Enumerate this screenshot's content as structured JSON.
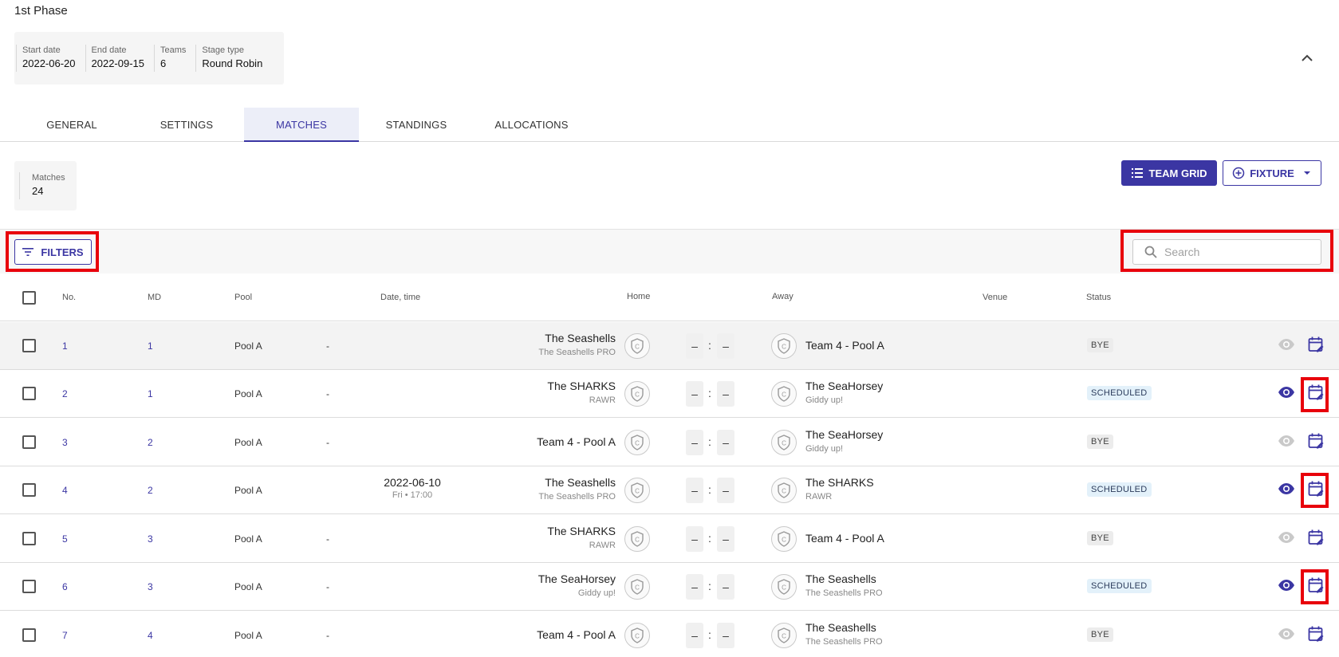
{
  "phase": {
    "title": "1st Phase",
    "info": [
      {
        "label": "Start date",
        "value": "2022-06-20"
      },
      {
        "label": "End date",
        "value": "2022-09-15"
      },
      {
        "label": "Teams",
        "value": "6"
      },
      {
        "label": "Stage type",
        "value": "Round Robin"
      }
    ]
  },
  "tabs": [
    {
      "label": "GENERAL",
      "active": false
    },
    {
      "label": "SETTINGS",
      "active": false
    },
    {
      "label": "MATCHES",
      "active": true
    },
    {
      "label": "STANDINGS",
      "active": false
    },
    {
      "label": "ALLOCATIONS",
      "active": false
    }
  ],
  "summary": {
    "label": "Matches",
    "value": "24"
  },
  "actions": {
    "team_grid": "TEAM GRID",
    "fixture": "FIXTURE"
  },
  "toolbar": {
    "filters": "FILTERS",
    "search_placeholder": "Search"
  },
  "table": {
    "headers": {
      "no": "No.",
      "md": "MD",
      "pool": "Pool",
      "datetime": "Date, time",
      "home": "Home",
      "away": "Away",
      "venue": "Venue",
      "status": "Status"
    },
    "rows": [
      {
        "no": "1",
        "md": "1",
        "pool": "Pool A",
        "dash": "-",
        "date": "",
        "time": "",
        "home": "The Seashells",
        "home_sub": "The Seashells PRO",
        "away": "Team 4 - Pool A",
        "away_sub": "",
        "score_home": "–",
        "score_away": "–",
        "status": "BYE",
        "eye_active": false
      },
      {
        "no": "2",
        "md": "1",
        "pool": "Pool A",
        "dash": "-",
        "date": "",
        "time": "",
        "home": "The SHARKS",
        "home_sub": "RAWR",
        "away": "The SeaHorsey",
        "away_sub": "Giddy up!",
        "score_home": "–",
        "score_away": "–",
        "status": "SCHEDULED",
        "eye_active": true
      },
      {
        "no": "3",
        "md": "2",
        "pool": "Pool A",
        "dash": "-",
        "date": "",
        "time": "",
        "home": "Team 4 - Pool A",
        "home_sub": "",
        "away": "The SeaHorsey",
        "away_sub": "Giddy up!",
        "score_home": "–",
        "score_away": "–",
        "status": "BYE",
        "eye_active": false
      },
      {
        "no": "4",
        "md": "2",
        "pool": "Pool A",
        "dash": "",
        "date": "2022-06-10",
        "time": "Fri • 17:00",
        "home": "The Seashells",
        "home_sub": "The Seashells PRO",
        "away": "The SHARKS",
        "away_sub": "RAWR",
        "score_home": "–",
        "score_away": "–",
        "status": "SCHEDULED",
        "eye_active": true
      },
      {
        "no": "5",
        "md": "3",
        "pool": "Pool A",
        "dash": "-",
        "date": "",
        "time": "",
        "home": "The SHARKS",
        "home_sub": "RAWR",
        "away": "Team 4 - Pool A",
        "away_sub": "",
        "score_home": "–",
        "score_away": "–",
        "status": "BYE",
        "eye_active": false
      },
      {
        "no": "6",
        "md": "3",
        "pool": "Pool A",
        "dash": "-",
        "date": "",
        "time": "",
        "home": "The SeaHorsey",
        "home_sub": "Giddy up!",
        "away": "The Seashells",
        "away_sub": "The Seashells PRO",
        "score_home": "–",
        "score_away": "–",
        "status": "SCHEDULED",
        "eye_active": true
      },
      {
        "no": "7",
        "md": "4",
        "pool": "Pool A",
        "dash": "-",
        "date": "",
        "time": "",
        "home": "Team 4 - Pool A",
        "home_sub": "",
        "away": "The Seashells",
        "away_sub": "The Seashells PRO",
        "score_home": "–",
        "score_away": "–",
        "status": "BYE",
        "eye_active": false
      }
    ]
  },
  "colors": {
    "accent": "#3b36a3",
    "highlight": "#e8000b"
  }
}
